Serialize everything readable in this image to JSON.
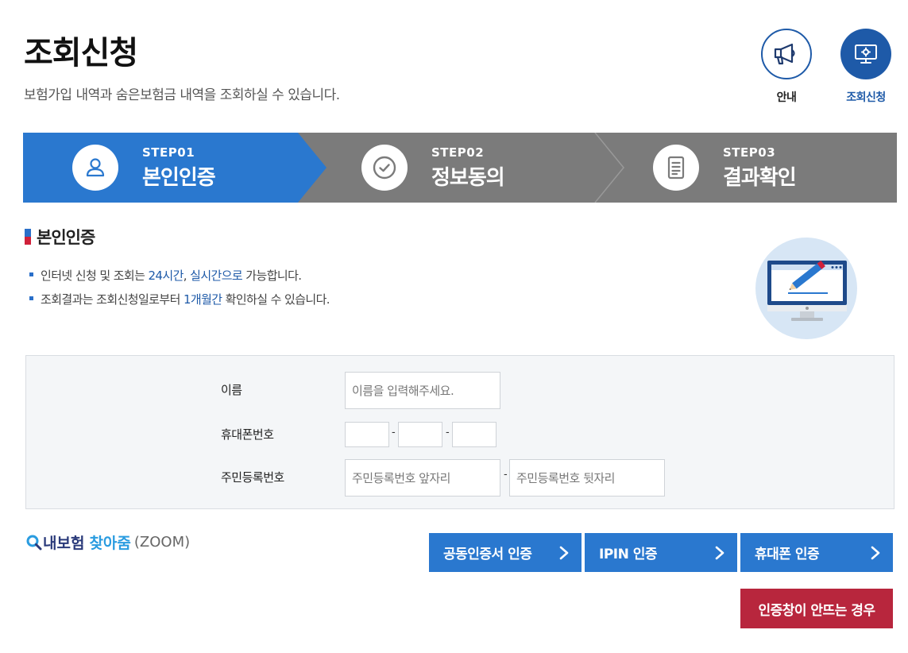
{
  "header": {
    "title": "조회신청",
    "subtitle": "보험가입 내역과 숨은보험금 내역을 조회하실 수 있습니다.",
    "buttons": [
      {
        "label": "안내",
        "icon": "megaphone-icon"
      },
      {
        "label": "조회신청",
        "icon": "monitor-search-icon"
      }
    ]
  },
  "steps": [
    {
      "code": "STEP01",
      "name": "본인인증",
      "icon": "user-icon",
      "active": true
    },
    {
      "code": "STEP02",
      "name": "정보동의",
      "icon": "check-circle-icon",
      "active": false
    },
    {
      "code": "STEP03",
      "name": "결과확인",
      "icon": "document-icon",
      "active": false
    }
  ],
  "section": {
    "title": "본인인증",
    "notes": [
      {
        "pre": "인터넷 신청 및 조회는 ",
        "hl1": "24시간",
        "mid": ", ",
        "hl2": "실시간으로",
        "post": " 가능합니다."
      },
      {
        "pre": "조회결과는 조회신청일로부터 ",
        "hl1": "1개월간",
        "post": " 확인하실 수 있습니다."
      }
    ]
  },
  "form": {
    "name_label": "이름",
    "name_placeholder": "이름을 입력해주세요.",
    "phone_label": "휴대폰번호",
    "phone_sep": "-",
    "rrn_label": "주민등록번호",
    "rrn_front_placeholder": "주민등록번호 앞자리",
    "rrn_back_placeholder": "주민등록번호 뒷자리",
    "rrn_sep": "-"
  },
  "zoom_logo": {
    "part1": "내보험",
    "part2": "찾아줌",
    "part3": "(ZOOM)"
  },
  "auth_buttons": [
    {
      "label": "공동인증서 인증"
    },
    {
      "label": "IPIN 인증"
    },
    {
      "label": "휴대폰 인증"
    }
  ],
  "help_button": "인증창이 안뜨는 경우",
  "colors": {
    "primary": "#2a78cf",
    "navy": "#1e5aa8",
    "step_inactive": "#7b7b7b",
    "warning": "#b8263d"
  }
}
